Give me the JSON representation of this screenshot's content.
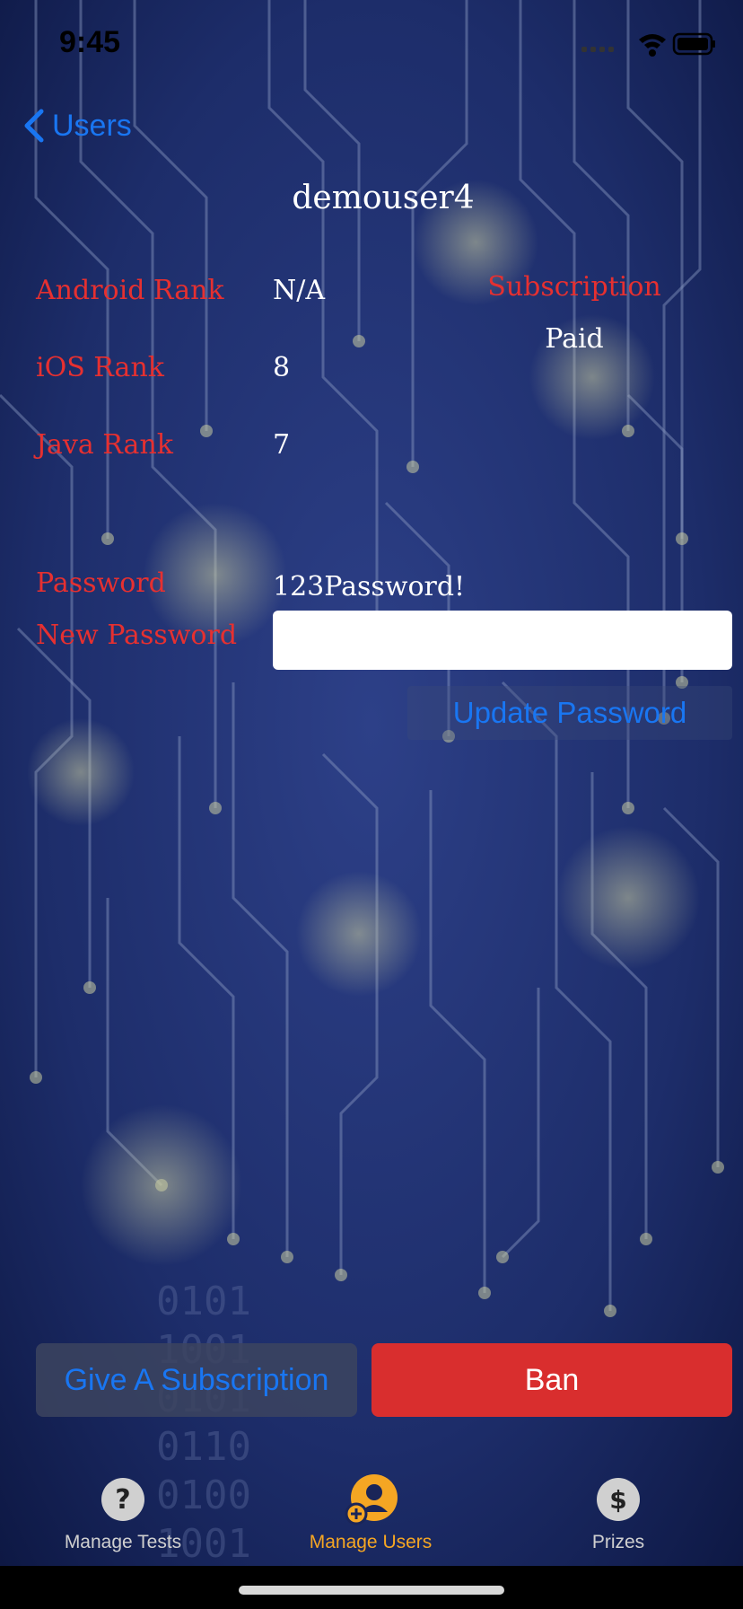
{
  "status_bar": {
    "time": "9:45"
  },
  "nav": {
    "back_label": "Users"
  },
  "profile": {
    "username": "demouser4",
    "android_rank_label": "Android Rank",
    "android_rank_value": "N/A",
    "ios_rank_label": "iOS Rank",
    "ios_rank_value": "8",
    "java_rank_label": "Java Rank",
    "java_rank_value": "7",
    "subscription_label": "Subscription",
    "subscription_value": "Paid",
    "password_label": "Password",
    "password_value": "123Password!",
    "new_password_label": "New Password",
    "new_password_value": "",
    "update_password_label": "Update Password"
  },
  "actions": {
    "give_subscription_label": "Give A Subscription",
    "ban_label": "Ban"
  },
  "tabbar": {
    "tabs": [
      {
        "label": "Manage Tests",
        "icon": "question-circle-icon",
        "active": false
      },
      {
        "label": "Manage Users",
        "icon": "add-user-icon",
        "active": true
      },
      {
        "label": "Prizes",
        "icon": "dollar-circle-icon",
        "active": false
      }
    ]
  },
  "background": {
    "binary_text": [
      "0101",
      "1001",
      "0101",
      "0110",
      "0100",
      "1001"
    ]
  },
  "colors": {
    "accent_blue": "#1976f2",
    "label_red": "#e63030",
    "ban_red": "#d92e2e",
    "tab_active": "#f5a623",
    "tab_inactive": "#d0d0d0"
  }
}
